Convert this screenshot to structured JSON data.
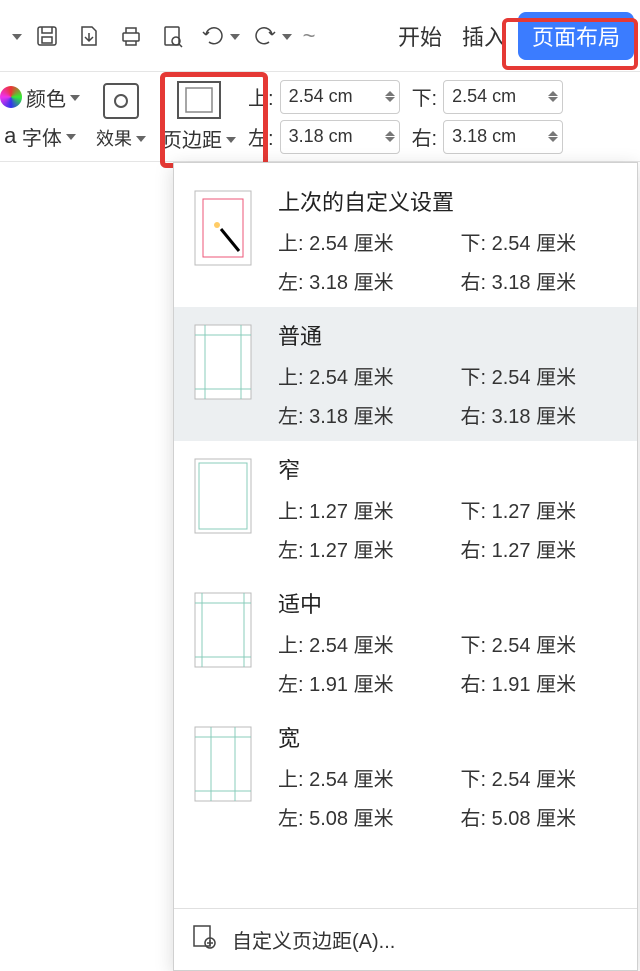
{
  "toolbar": {
    "tabs": {
      "start": "开始",
      "insert": "插入",
      "page_layout": "页面布局"
    }
  },
  "second_row": {
    "color_label": "颜色",
    "font_label": "字体",
    "effects_label": "效果",
    "margins_label": "页边距",
    "margin_labels": {
      "top": "上:",
      "bottom": "下:",
      "left": "左:",
      "right": "右:"
    },
    "values": {
      "top": "2.54 cm",
      "bottom": "2.54 cm",
      "left": "3.18 cm",
      "right": "3.18 cm"
    }
  },
  "dropdown": {
    "presets": [
      {
        "title": "上次的自定义设置",
        "top": "上: 2.54 厘米",
        "bottom": "下: 2.54 厘米",
        "left": "左: 3.18 厘米",
        "right": "右: 3.18 厘米"
      },
      {
        "title": "普通",
        "top": "上: 2.54 厘米",
        "bottom": "下: 2.54 厘米",
        "left": "左: 3.18 厘米",
        "right": "右: 3.18 厘米"
      },
      {
        "title": "窄",
        "top": "上: 1.27 厘米",
        "bottom": "下: 1.27 厘米",
        "left": "左: 1.27 厘米",
        "right": "右: 1.27 厘米"
      },
      {
        "title": "适中",
        "top": "上: 2.54 厘米",
        "bottom": "下: 2.54 厘米",
        "left": "左: 1.91 厘米",
        "right": "右: 1.91 厘米"
      },
      {
        "title": "宽",
        "top": "上: 2.54 厘米",
        "bottom": "下: 2.54 厘米",
        "left": "左: 5.08 厘米",
        "right": "右: 5.08 厘米"
      }
    ],
    "footer_label": "自定义页边距(A)..."
  }
}
